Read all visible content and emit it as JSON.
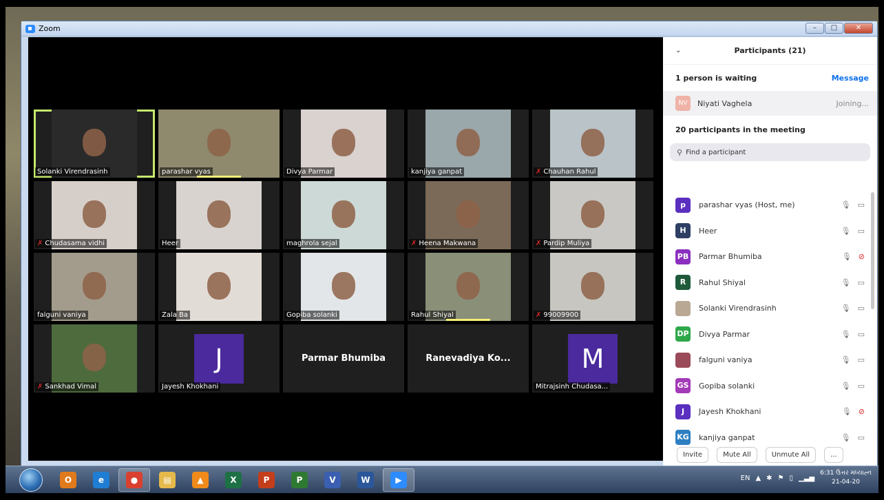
{
  "window": {
    "title": "Zoom",
    "minimize": "–",
    "maximize": "□",
    "close": "✕"
  },
  "gallery": {
    "tiles": [
      {
        "name": "Solanki Virendrasinh",
        "muted": false,
        "active": true,
        "type": "video",
        "color": "#2a2a2a"
      },
      {
        "name": "parashar vyas",
        "muted": false,
        "type": "video",
        "color": "#8f8a6e"
      },
      {
        "name": "Divya Parmar",
        "muted": false,
        "type": "video",
        "color": "#d9d2cf"
      },
      {
        "name": "kanjiya ganpat",
        "muted": false,
        "type": "video",
        "color": "#9aa7ab"
      },
      {
        "name": "Chauhan Rahul",
        "muted": true,
        "type": "video",
        "color": "#b9c3c8"
      },
      {
        "name": "Chudasama vidhi",
        "muted": true,
        "type": "video",
        "color": "#d6cfc9"
      },
      {
        "name": "Heer",
        "muted": false,
        "type": "video",
        "color": "#d8d3cf"
      },
      {
        "name": "maghrola sejal",
        "muted": false,
        "type": "video",
        "color": "#cdd9d6"
      },
      {
        "name": "Heena Makwana",
        "muted": true,
        "type": "video",
        "color": "#7b6a58"
      },
      {
        "name": "Pardip Muliya",
        "muted": true,
        "type": "video",
        "color": "#c9c8c4"
      },
      {
        "name": "falguni vaniya",
        "muted": false,
        "type": "video",
        "color": "#a39c8c"
      },
      {
        "name": "Zala Ba",
        "muted": false,
        "type": "video",
        "color": "#e2dcd6"
      },
      {
        "name": "Gopiba solanki",
        "muted": false,
        "type": "video",
        "color": "#e3e6e8"
      },
      {
        "name": "Rahul Shiyal",
        "muted": false,
        "type": "video",
        "color": "#8a8f78"
      },
      {
        "name": "99009900",
        "muted": true,
        "type": "video",
        "color": "#c7c6c0"
      },
      {
        "name": "Sankhad Vimal",
        "muted": true,
        "type": "video",
        "color": "#4e6b3e"
      },
      {
        "name": "Jayesh Khokhani",
        "muted": false,
        "type": "avatar",
        "initial": "J",
        "color": "#4a2a9c"
      },
      {
        "name": "Parmar Bhumiba",
        "type": "name"
      },
      {
        "name": "Ranevadiya  Ko...",
        "type": "name"
      },
      {
        "name": "Mitrajsinh Chudasa...",
        "muted": false,
        "type": "avatar",
        "initial": "M",
        "color": "#4a2a9c"
      }
    ]
  },
  "panel": {
    "title": "Participants (21)",
    "waiting_label": "1 person is waiting",
    "message_label": "Message",
    "waiting_person": {
      "initials": "NV",
      "name": "Niyati Vaghela",
      "status": "Joining..."
    },
    "in_meeting_label": "20 participants in the meeting",
    "search_placeholder": "Find a participant",
    "participants": [
      {
        "initials": "p",
        "name": "parashar vyas (Host, me)",
        "color": "#5b2fbf",
        "video_off": false
      },
      {
        "initials": "H",
        "name": "Heer",
        "color": "#2e3f63",
        "video_off": false
      },
      {
        "initials": "PB",
        "name": "Parmar Bhumiba",
        "color": "#8a2fbf",
        "video_off": true
      },
      {
        "initials": "R",
        "name": "Rahul Shiyal",
        "color": "#1f5a3a",
        "video_off": false
      },
      {
        "initials": "",
        "name": "Solanki Virendrasinh",
        "color": "#b8a894",
        "video_off": false
      },
      {
        "initials": "DP",
        "name": "Divya Parmar",
        "color": "#2ea84a",
        "video_off": false
      },
      {
        "initials": "",
        "name": "falguni vaniya",
        "color": "#9b4a5a",
        "video_off": false
      },
      {
        "initials": "GS",
        "name": "Gopiba solanki",
        "color": "#a33ab8",
        "video_off": false
      },
      {
        "initials": "J",
        "name": "Jayesh Khokhani",
        "color": "#5b2fbf",
        "video_off": true
      },
      {
        "initials": "KG",
        "name": "kanjiya ganpat",
        "color": "#2d7fc2",
        "video_off": false
      }
    ],
    "footer": {
      "invite": "Invite",
      "mute_all": "Mute All",
      "unmute_all": "Unmute All",
      "more": "..."
    }
  },
  "taskbar": {
    "apps": [
      {
        "icon": "outlook-icon",
        "label": "O",
        "color": "#e07a1c"
      },
      {
        "icon": "ie-icon",
        "label": "e",
        "color": "#1f7ed3"
      },
      {
        "icon": "chrome-icon",
        "label": "●",
        "color": "#d9402f"
      },
      {
        "icon": "explorer-icon",
        "label": "▤",
        "color": "#e5b94a"
      },
      {
        "icon": "vlc-icon",
        "label": "▲",
        "color": "#f08a1a"
      },
      {
        "icon": "excel-icon",
        "label": "X",
        "color": "#1e7145"
      },
      {
        "icon": "powerpoint-icon",
        "label": "P",
        "color": "#c43e1c"
      },
      {
        "icon": "project-icon",
        "label": "P",
        "color": "#2f7a32"
      },
      {
        "icon": "visio-icon",
        "label": "V",
        "color": "#3b5fb0"
      },
      {
        "icon": "word-icon",
        "label": "W",
        "color": "#2b579a"
      },
      {
        "icon": "zoom-icon",
        "label": "▶",
        "color": "#2d8cff"
      }
    ],
    "lang": "EN",
    "time": "6:31 ઉત્તર મધ્યાહ્ન",
    "date": "21-04-20"
  }
}
